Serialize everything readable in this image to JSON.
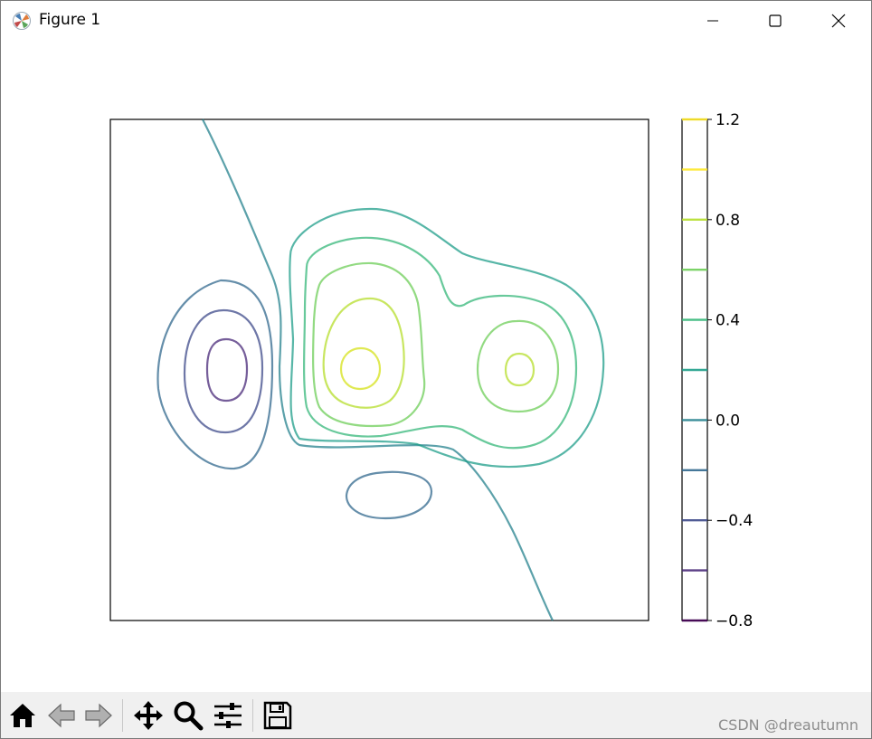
{
  "window": {
    "title": "Figure 1"
  },
  "toolbar": {
    "buttons": [
      "home-icon",
      "back-arrow-icon",
      "forward-arrow-icon",
      "pan-move-icon",
      "zoom-magnifier-icon",
      "configure-subplots-icon",
      "save-floppy-icon"
    ],
    "watermark": "CSDN @dreautumn"
  },
  "chart_data": {
    "type": "contour",
    "title": "",
    "xlabel": "",
    "ylabel": "",
    "axis_ticks_visible": false,
    "colormap": "viridis",
    "contour_levels": [
      -0.8,
      -0.6,
      -0.4,
      -0.2,
      0.0,
      0.2,
      0.4,
      0.6,
      0.8,
      1.0,
      1.2
    ],
    "contour_colors": [
      "#440154",
      "#482878",
      "#3e4a89",
      "#31688e",
      "#26828e",
      "#1f9e89",
      "#35b779",
      "#6ece58",
      "#b5de2b",
      "#fde725",
      "#fde725"
    ],
    "line_alpha": 0.75,
    "colorbar": {
      "tick_labels": [
        "1.2",
        "0.8",
        "0.4",
        "0.0",
        "−0.4",
        "−0.8"
      ],
      "tick_values": [
        1.2,
        0.8,
        0.4,
        0.0,
        -0.4,
        -0.8
      ],
      "min": -0.8,
      "max": 1.2
    }
  }
}
